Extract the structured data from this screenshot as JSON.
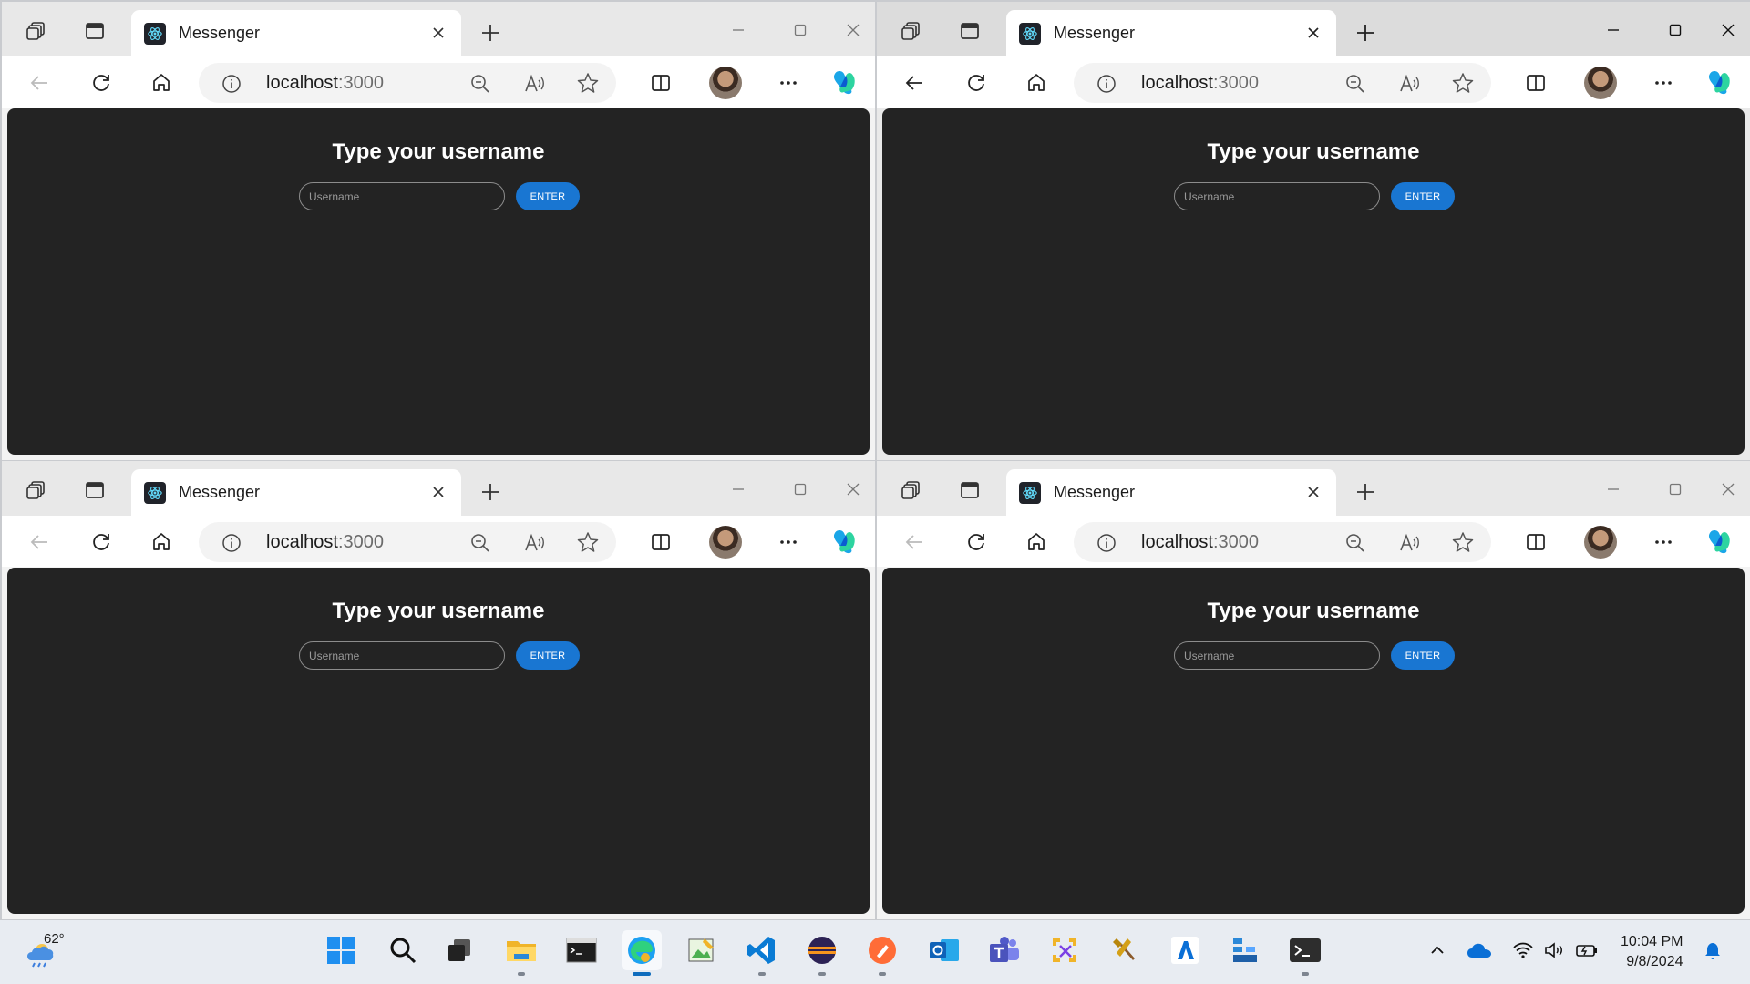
{
  "browser": {
    "tab_title": "Messenger",
    "url_host": "localhost",
    "url_port": ":3000"
  },
  "page": {
    "heading": "Type your username",
    "username_placeholder": "Username",
    "username_value": "",
    "enter_label": "ENTER"
  },
  "windows": [
    {
      "id": "top-left",
      "active": false,
      "back_enabled": false
    },
    {
      "id": "top-right",
      "active": true,
      "back_enabled": true
    },
    {
      "id": "bottom-left",
      "active": false,
      "back_enabled": false
    },
    {
      "id": "bottom-right",
      "active": false,
      "back_enabled": false
    }
  ],
  "taskbar": {
    "weather_temp": "62°",
    "apps": [
      {
        "name": "start-icon"
      },
      {
        "name": "search-icon"
      },
      {
        "name": "task-view-icon"
      },
      {
        "name": "file-explorer-icon"
      },
      {
        "name": "command-prompt-icon"
      },
      {
        "name": "edge-icon"
      },
      {
        "name": "image-editor-icon"
      },
      {
        "name": "vscode-icon"
      },
      {
        "name": "eclipse-icon"
      },
      {
        "name": "postman-icon"
      },
      {
        "name": "outlook-icon"
      },
      {
        "name": "teams-icon"
      },
      {
        "name": "snipping-tool-icon"
      },
      {
        "name": "tools-icon"
      },
      {
        "name": "azure-icon"
      },
      {
        "name": "network-app-icon"
      },
      {
        "name": "terminal-icon"
      }
    ],
    "time": "10:04 PM",
    "date": "9/8/2024"
  },
  "colors": {
    "page_bg": "#232323",
    "enter_button": "#1976d2",
    "text": "#ffffff"
  }
}
